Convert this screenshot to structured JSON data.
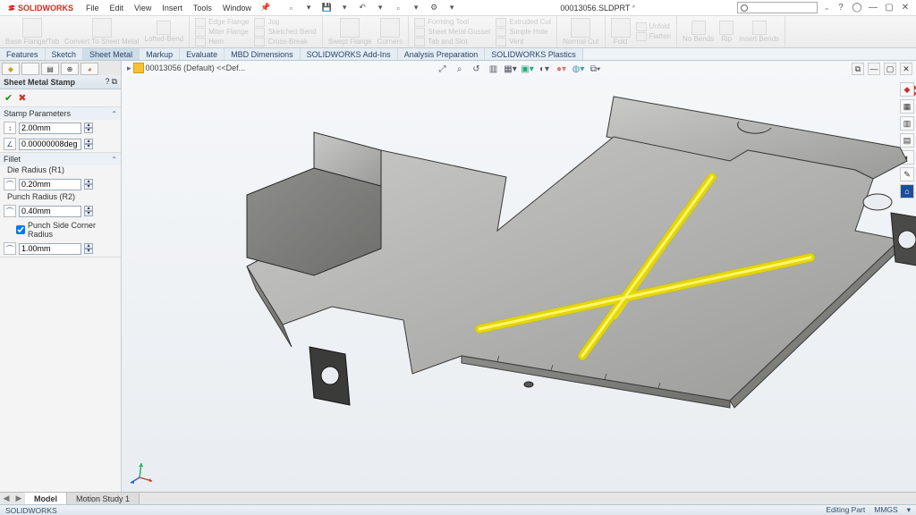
{
  "app": {
    "brand": "SOLIDWORKS",
    "doc": "00013056.SLDPRT"
  },
  "menus": [
    "File",
    "Edit",
    "View",
    "Insert",
    "Tools",
    "Window"
  ],
  "search": {
    "placeholder": "none",
    "value": ""
  },
  "ribbon": {
    "groups": [
      [
        "Base Flange/Tab",
        "Convert To Sheet Metal",
        "Lofted-Bend"
      ],
      [
        "Edge Flange",
        "Miter Flange",
        "Hem",
        "Jog",
        "Sketched Bend",
        "Cross-Break"
      ],
      [
        "Swept Flange",
        "Corners"
      ],
      [
        "Forming Tool",
        "Sheet Metal Gusset",
        "Tab and Slot",
        "Extruded Cut",
        "Simple Hole",
        "Vent"
      ],
      [
        "Normal Cut"
      ],
      [
        "Fold",
        "Unfold",
        "Flatten"
      ],
      [
        "No Bends",
        "Rip",
        "Insert Bends"
      ]
    ]
  },
  "feature_tabs": [
    "Features",
    "Sketch",
    "Sheet Metal",
    "Markup",
    "Evaluate",
    "MBD Dimensions",
    "SOLIDWORKS Add-Ins",
    "Analysis Preparation",
    "SOLIDWORKS Plastics"
  ],
  "active_feature_tab": "Sheet Metal",
  "pm": {
    "title": "Sheet Metal Stamp",
    "sections": {
      "stamp": {
        "label": "Stamp Parameters",
        "depth": "2.00mm",
        "angle": "0.00000008deg"
      },
      "fillet": {
        "label": "Fillet",
        "die_label": "Die Radius (R1)",
        "die": "0.20mm",
        "punch_label": "Punch Radius (R2)",
        "punch": "0.40mm",
        "corner_chk": "Punch Side Corner Radius",
        "corner": "1.00mm"
      }
    }
  },
  "crumb": "00013056 (Default) <<Def...",
  "bottom_tabs": [
    "Model",
    "Motion Study 1"
  ],
  "active_bottom_tab": "Model",
  "status": {
    "left": "SOLIDWORKS",
    "right_mode": "Editing Part",
    "units": "MMGS"
  }
}
